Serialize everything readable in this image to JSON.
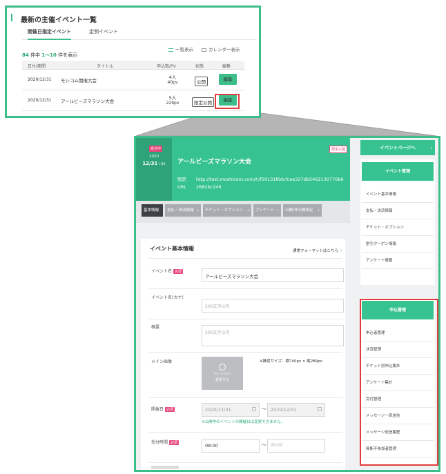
{
  "top_panel": {
    "title": "最新の主催イベント一覧",
    "tabs": [
      "開催日指定イベント",
      "定例イベント"
    ],
    "views": [
      "一覧表示",
      "カレンダー表示"
    ],
    "count": {
      "total": "84",
      "label1": "件中",
      "range": "1〜10",
      "label2": "件を表示"
    },
    "columns": [
      "日付/期間",
      "タイトル",
      "申込数/PV",
      "状態",
      "編集"
    ],
    "rows": [
      {
        "date": "2020/12/31",
        "title": "モシコム開催大会",
        "apply": "4人",
        "pv": "40pv",
        "status": "公開",
        "edit": "編集"
      },
      {
        "date": "2020/12/31",
        "title": "アールビーズマラソン大会",
        "apply": "5人",
        "pv": "229pv",
        "status": "限定公開",
        "edit": "編集"
      }
    ]
  },
  "detail_panel": {
    "badge": "受付中",
    "year": "2020",
    "day": "12/31",
    "weekday": "(木)",
    "event_title": "アールビーズマラソン大会",
    "private_badge": "限定公開",
    "url_label": "限定URL",
    "url": "http://test.moshicom.com/h/f59131f6dcfcee327db5462130776b62682bc246",
    "steps": [
      "基本情報",
      "支払・決済情報",
      "チケット・オプション",
      "アンケート",
      "公開/非公開設定"
    ],
    "form": {
      "title": "イベント基本情報",
      "format_link": "通常フォーマットはこちら",
      "required": "必須",
      "name_label": "イベント名",
      "name_value": "アールビーズマラソン大会",
      "kana_label": "イベント名(カナ)",
      "kana_placeholder": "200文字以内",
      "summary_label": "概要",
      "summary_placeholder": "200文字以内",
      "image_label": "メイン画像",
      "image_hint": "No image",
      "image_change": "変更する",
      "image_note": "※推奨サイズ：横740px × 縦289px",
      "date_label": "開催日",
      "date_from": "2020/12/31",
      "date_to": "2020/12/31",
      "date_sep": "〜",
      "date_note": "※公開中のイベントの開催日は変更できません。",
      "time_label": "受付時間",
      "time_from": "08:00",
      "time_to_placeholder": "00:00"
    }
  },
  "sidebar": {
    "event_page_button": "イベントページへ",
    "event_mgmt": {
      "title": "イベント管理",
      "items": [
        "イベント基本情報",
        "支払・決済情報",
        "チケット・オプション",
        "割引クーポン情報",
        "アンケート情報"
      ]
    },
    "apply_mgmt": {
      "title": "申込管理",
      "items": [
        "申込者管理",
        "決済管理",
        "チケット別申込集計",
        "アンケート集計",
        "受付管理",
        "メッセージ一斉送信",
        "メッセージ送信履歴",
        "無断不参加者管理"
      ]
    }
  },
  "colors": {
    "accent": "#3dbd8a",
    "highlight": "#e23b3b",
    "badge": "#e6457a"
  }
}
